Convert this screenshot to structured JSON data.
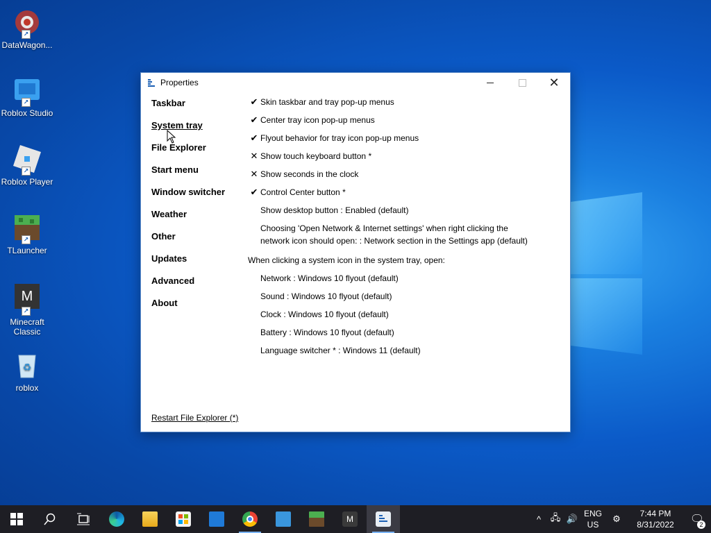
{
  "desktop": {
    "icons": [
      {
        "label": "DataWagon...",
        "icon": "datawagon-icon"
      },
      {
        "label": "Roblox Studio",
        "icon": "roblox-studio-icon"
      },
      {
        "label": "Roblox Player",
        "icon": "roblox-player-icon"
      },
      {
        "label": "TLauncher",
        "icon": "tlauncher-icon"
      },
      {
        "label": "Minecraft Classic",
        "icon": "minecraft-classic-icon",
        "glyph": "M"
      },
      {
        "label": "roblox",
        "icon": "recycle-bin-icon"
      }
    ]
  },
  "window": {
    "title": "Properties",
    "close_glyph": "✕"
  },
  "nav": {
    "items": [
      "Taskbar",
      "System tray",
      "File Explorer",
      "Start menu",
      "Window switcher",
      "Weather",
      "Other",
      "Updates",
      "Advanced",
      "About"
    ],
    "active": "System tray"
  },
  "options": [
    {
      "mark": "✔",
      "text": "Skin taskbar and tray pop-up menus"
    },
    {
      "mark": "✔",
      "text": "Center tray icon pop-up menus"
    },
    {
      "mark": "✔",
      "text": "Flyout behavior for tray icon pop-up menus"
    },
    {
      "mark": "✕",
      "text": "Show touch keyboard button *"
    },
    {
      "mark": "✕",
      "text": "Show seconds in the clock"
    },
    {
      "mark": "✔",
      "text": "Control Center button *"
    },
    {
      "mark": "",
      "text": "Show desktop button : Enabled (default)"
    },
    {
      "mark": "",
      "text": "Choosing 'Open Network & Internet settings' when right clicking the network icon should open: : Network section in the Settings app (default)"
    }
  ],
  "system_icon_heading": "When clicking a system icon in the system tray, open:",
  "system_icon_options": [
    "Network : Windows 10 flyout (default)",
    "Sound : Windows 10 flyout (default)",
    "Clock : Windows 10 flyout (default)",
    "Battery : Windows 10 flyout (default)",
    "Language switcher * : Windows 11 (default)"
  ],
  "restart_link": "Restart File Explorer (*)",
  "taskbar": {
    "lang_top": "ENG",
    "lang_bottom": "US",
    "time": "7:44 PM",
    "date": "8/31/2022",
    "notification_count": "2",
    "colors": {
      "bg": "#1e1e24",
      "accent": "#7ab4f5"
    }
  }
}
